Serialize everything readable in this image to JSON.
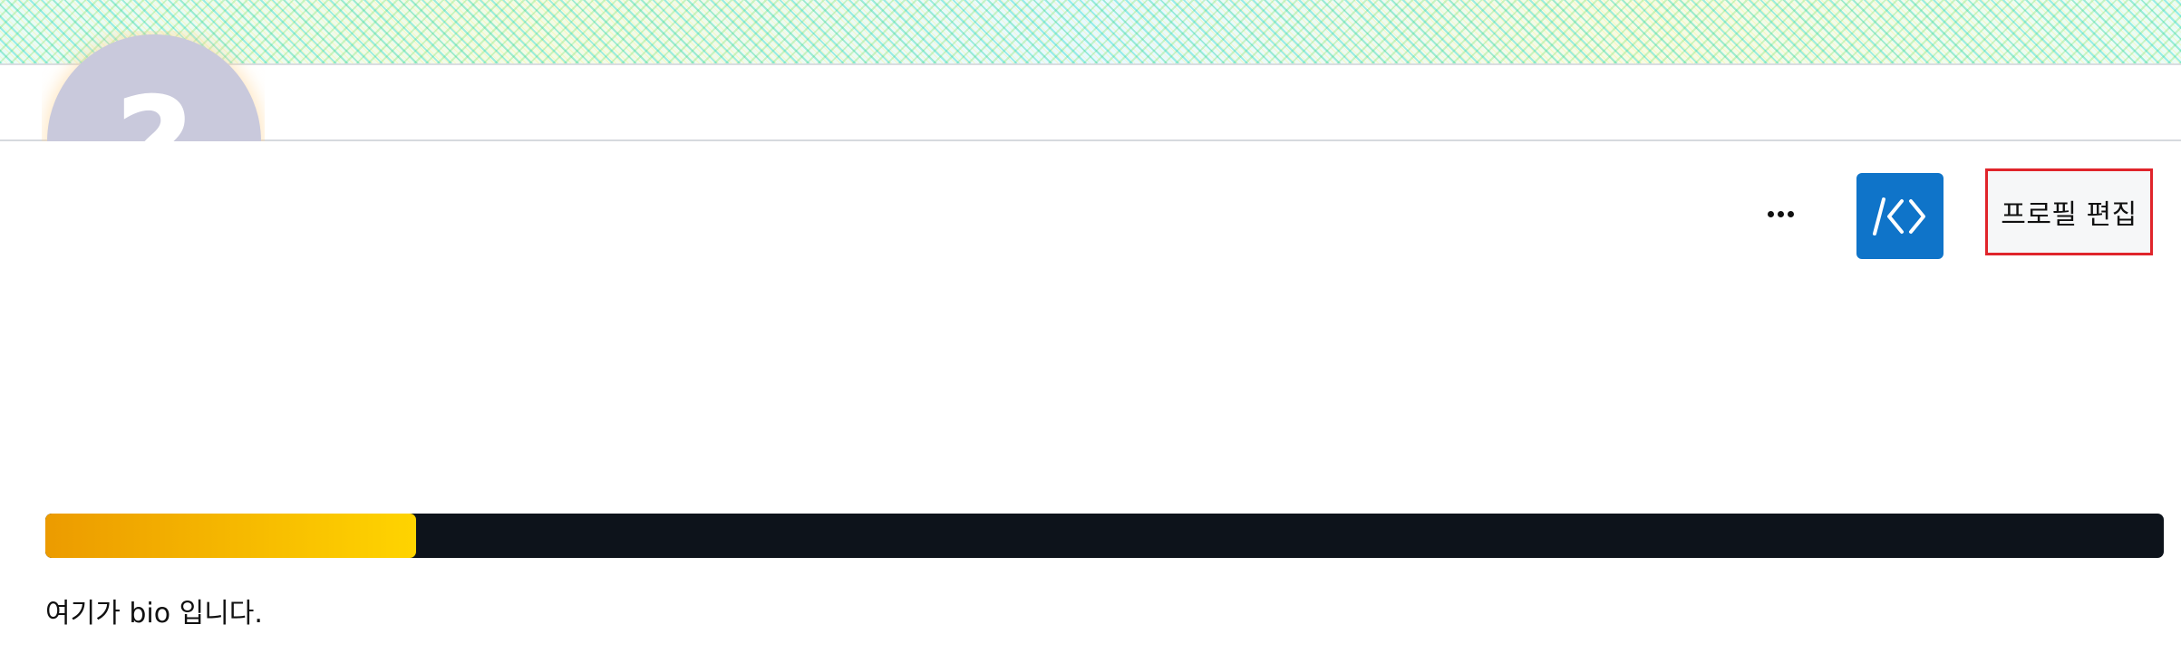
{
  "header": {
    "avatar_glyph": "?"
  },
  "actions": {
    "more_label": "…",
    "code_icon_name": "code-brackets-icon",
    "edit_profile_label": "프로필 편집"
  },
  "level": {
    "label": "",
    "progress_fraction": 0.175,
    "fill_colors": [
      "#ec9b00",
      "#ffd400"
    ],
    "track_color": "#0d131b"
  },
  "profile": {
    "bio": "여기가 bio 입니다."
  },
  "colors": {
    "accent_blue": "#0f74c9",
    "highlight_red": "#e0242b",
    "avatar_bg": "#c9c9dc"
  }
}
